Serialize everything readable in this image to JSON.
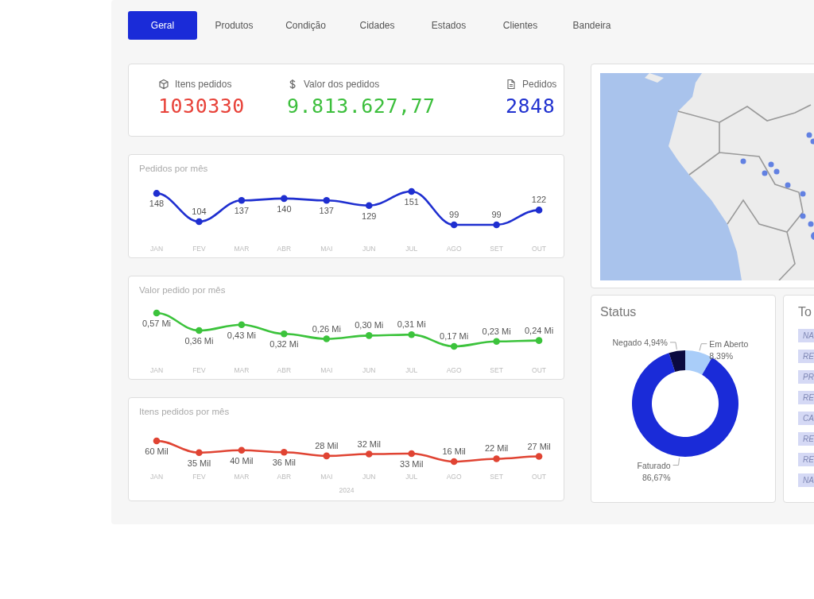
{
  "tabs": [
    {
      "label": "Geral",
      "selected": true
    },
    {
      "label": "Produtos",
      "selected": false
    },
    {
      "label": "Condição",
      "selected": false
    },
    {
      "label": "Cidades",
      "selected": false
    },
    {
      "label": "Estados",
      "selected": false
    },
    {
      "label": "Clientes",
      "selected": false
    },
    {
      "label": "Bandeira",
      "selected": false
    }
  ],
  "kpis": [
    {
      "kind": "items",
      "label": "Itens pedidos",
      "value": "1030330",
      "color": "#e8433a"
    },
    {
      "kind": "money",
      "label": "Valor dos pedidos",
      "value": "9.813.627,77",
      "color": "#3dbf3d"
    },
    {
      "kind": "orders",
      "label": "Pedidos",
      "value": "2848",
      "color": "#2233d0"
    }
  ],
  "charts": [
    {
      "title": "Pedidos por mês",
      "chart_data": {
        "type": "line",
        "categories": [
          "JAN",
          "FEV",
          "MAR",
          "ABR",
          "MAI",
          "JUN",
          "JUL",
          "AGO",
          "SET",
          "OUT"
        ],
        "series": [
          {
            "color": "#1f2fd0",
            "marker": true,
            "values": [
              148,
              104,
              137,
              140,
              137,
              129,
              151,
              99,
              99,
              122
            ]
          }
        ],
        "data_labels": true
      }
    },
    {
      "title": "Valor pedido por mês",
      "chart_data": {
        "type": "line",
        "categories": [
          "JAN",
          "FEV",
          "MAR",
          "ABR",
          "MAI",
          "JUN",
          "JUL",
          "AGO",
          "SET",
          "OUT"
        ],
        "series": [
          {
            "color": "#3cc33c",
            "marker": true,
            "values": [
              0.57,
              0.36,
              0.43,
              0.32,
              0.26,
              0.3,
              0.31,
              0.17,
              0.23,
              0.24
            ],
            "value_labels": [
              "0,57 Mi",
              "0,36 Mi",
              "0,43 Mi",
              "0,32 Mi",
              "0,26 Mi",
              "0,30 Mi",
              "0,31 Mi",
              "0,17 Mi",
              "0,23 Mi",
              "0,24 Mi"
            ]
          }
        ]
      }
    },
    {
      "title": "Itens pedidos por mês",
      "chart_data": {
        "type": "line",
        "xlabel": "2024",
        "categories": [
          "JAN",
          "FEV",
          "MAR",
          "ABR",
          "MAI",
          "JUN",
          "JUL",
          "AGO",
          "SET",
          "OUT"
        ],
        "series": [
          {
            "color": "#e04433",
            "marker": true,
            "values": [
              60,
              35,
              40,
              36,
              28,
              32,
              33,
              16,
              22,
              27
            ],
            "value_labels": [
              "60 Mil",
              "35 Mil",
              "40 Mil",
              "36 Mil",
              "28 Mil",
              "32 Mil",
              "33 Mil",
              "16 Mil",
              "22 Mil",
              "27 Mil"
            ]
          }
        ]
      }
    }
  ],
  "status": {
    "title": "Status",
    "chart_data": {
      "type": "donut",
      "categories": [
        "Em Aberto",
        "Faturado",
        "Negado"
      ],
      "series": [
        {
          "values": [
            8.39,
            86.67,
            4.94
          ]
        }
      ],
      "colors": [
        "#a9cdf9",
        "#1a2bd8",
        "#0b0a40"
      ],
      "value_labels": [
        "8,39%",
        "86,67%",
        "4,94%"
      ]
    }
  },
  "top": {
    "title": "To",
    "tags": [
      "NA",
      "RE",
      "PR",
      "RE",
      "CA",
      "RE",
      "RE",
      "NA"
    ]
  }
}
